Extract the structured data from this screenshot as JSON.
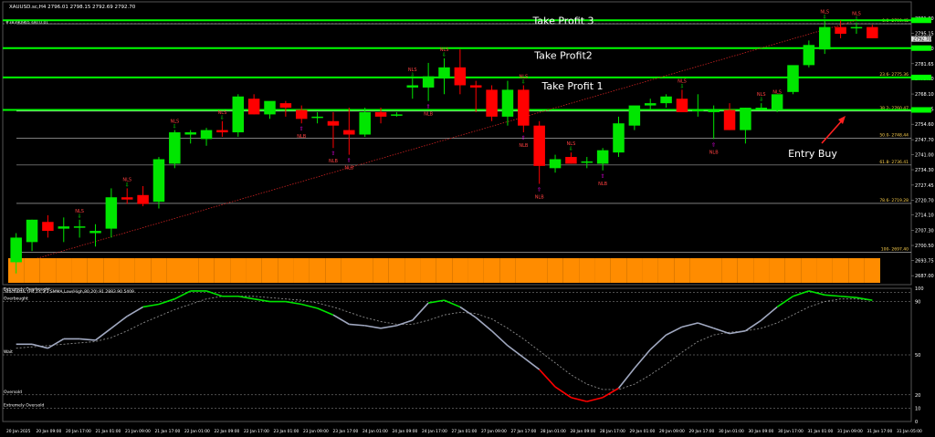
{
  "header": {
    "symbol_line": "XAUUSD.sc,H4  2796.01 2798.15 2792.69 2792.70",
    "order_line": "#38390965 sell 0.01"
  },
  "annotations": {
    "tp3": "Take Profit 3",
    "tp2": "Take Profit2",
    "tp1": "Take Profit 1",
    "entry": "Entry Buy"
  },
  "colors": {
    "background": "#000000",
    "bull": "#00e600",
    "bear": "#ff0000",
    "level_line": "#00ff00",
    "fib_line": "#c8c8c8",
    "volume": "#ff8c00",
    "stoch_main": "#a0a8c0",
    "stoch_signal": "#8c8c8c",
    "text": "#ffffff",
    "arrow_up": "#ff00ff",
    "label": "#ff4040"
  },
  "chart_data": [
    {
      "type": "candlestick",
      "title": "XAUUSD.sc,H4",
      "ylim": [
        2683,
        2806
      ],
      "price_ticks": [
        "2801.90",
        "2795.15",
        "2788.40",
        "2781.65",
        "2775.00",
        "2768.10",
        "2761.35",
        "2754.60",
        "2747.70",
        "2741.00",
        "2734.30",
        "2727.45",
        "2720.70",
        "2714.10",
        "2707.30",
        "2700.50",
        "2693.75",
        "2687.00"
      ],
      "current_price": "2792.70",
      "current_label": "2792.70",
      "fib_levels": [
        {
          "label": "0.0- 2799.45",
          "value": 2799.45
        },
        {
          "label": "23.6- 2775.36",
          "value": 2775.36
        },
        {
          "label": "38.2- 2760.47",
          "value": 2760.47
        },
        {
          "label": "50.0- 2748.44",
          "value": 2748.44
        },
        {
          "label": "61.8- 2736.41",
          "value": 2736.41
        },
        {
          "label": "78.6- 2719.28",
          "value": 2719.28
        },
        {
          "label": "100- 2697.40",
          "value": 2697.4
        }
      ],
      "green_levels": [
        {
          "name": "tp3",
          "value": 2801.0
        },
        {
          "name": "tp2",
          "value": 2788.6
        },
        {
          "name": "tp1",
          "value": 2775.5
        },
        {
          "name": "entry",
          "value": 2761.0
        }
      ],
      "time_labels": [
        "20 Jan 2025",
        "20 Jan 09:00",
        "20 Jan 17:00",
        "21 Jan 01:00",
        "21 Jan 09:00",
        "21 Jan 17:00",
        "22 Jan 01:00",
        "22 Jan 09:00",
        "22 Jan 17:00",
        "23 Jan 01:00",
        "23 Jan 09:00",
        "23 Jan 17:00",
        "24 Jan 01:00",
        "24 Jan 09:00",
        "24 Jan 17:00",
        "27 Jan 01:00",
        "27 Jan 09:00",
        "27 Jan 17:00",
        "28 Jan 01:00",
        "28 Jan 09:00",
        "28 Jan 17:00",
        "29 Jan 01:00",
        "29 Jan 09:00",
        "29 Jan 17:00",
        "30 Jan 01:00",
        "30 Jan 09:00",
        "30 Jan 17:00",
        "31 Jan 01:00",
        "31 Jan 09:00",
        "31 Jan 17:00",
        "31 Jan 05:00"
      ],
      "candles": [
        {
          "o": 2693,
          "h": 2706,
          "l": 2688,
          "c": 2704
        },
        {
          "o": 2702,
          "h": 2712,
          "l": 2698,
          "c": 2712
        },
        {
          "o": 2711,
          "h": 2714,
          "l": 2704,
          "c": 2707
        },
        {
          "o": 2708,
          "h": 2713,
          "l": 2702,
          "c": 2709
        },
        {
          "o": 2709,
          "h": 2712,
          "l": 2704,
          "c": 2709
        },
        {
          "o": 2706,
          "h": 2710,
          "l": 2700,
          "c": 2707
        },
        {
          "o": 2708,
          "h": 2726,
          "l": 2704,
          "c": 2722
        },
        {
          "o": 2722,
          "h": 2726,
          "l": 2719,
          "c": 2721
        },
        {
          "o": 2723,
          "h": 2727,
          "l": 2718,
          "c": 2719
        },
        {
          "o": 2720,
          "h": 2740,
          "l": 2717,
          "c": 2739
        },
        {
          "o": 2737,
          "h": 2752,
          "l": 2735,
          "c": 2751
        },
        {
          "o": 2750,
          "h": 2752,
          "l": 2746,
          "c": 2751
        },
        {
          "o": 2748,
          "h": 2753,
          "l": 2745,
          "c": 2752
        },
        {
          "o": 2752,
          "h": 2756,
          "l": 2749,
          "c": 2751
        },
        {
          "o": 2751,
          "h": 2768,
          "l": 2749,
          "c": 2767
        },
        {
          "o": 2766,
          "h": 2768,
          "l": 2759,
          "c": 2759
        },
        {
          "o": 2759,
          "h": 2764,
          "l": 2757,
          "c": 2765
        },
        {
          "o": 2764,
          "h": 2765,
          "l": 2758,
          "c": 2762
        },
        {
          "o": 2761,
          "h": 2763,
          "l": 2755,
          "c": 2757
        },
        {
          "o": 2758,
          "h": 2760,
          "l": 2755,
          "c": 2758
        },
        {
          "o": 2756,
          "h": 2760,
          "l": 2744,
          "c": 2754
        },
        {
          "o": 2752,
          "h": 2762,
          "l": 2741,
          "c": 2750
        },
        {
          "o": 2750,
          "h": 2762,
          "l": 2749,
          "c": 2760
        },
        {
          "o": 2760,
          "h": 2762,
          "l": 2755,
          "c": 2758
        },
        {
          "o": 2759,
          "h": 2760,
          "l": 2758,
          "c": 2759
        },
        {
          "o": 2771,
          "h": 2775,
          "l": 2766,
          "c": 2772
        },
        {
          "o": 2771,
          "h": 2782,
          "l": 2765,
          "c": 2776
        },
        {
          "o": 2775,
          "h": 2784,
          "l": 2768,
          "c": 2780
        },
        {
          "o": 2780,
          "h": 2788,
          "l": 2768,
          "c": 2772
        },
        {
          "o": 2772,
          "h": 2774,
          "l": 2760,
          "c": 2771
        },
        {
          "o": 2770,
          "h": 2772,
          "l": 2756,
          "c": 2758
        },
        {
          "o": 2758,
          "h": 2774,
          "l": 2754,
          "c": 2770
        },
        {
          "o": 2770,
          "h": 2772,
          "l": 2751,
          "c": 2754
        },
        {
          "o": 2754,
          "h": 2756,
          "l": 2728,
          "c": 2736
        },
        {
          "o": 2735,
          "h": 2741,
          "l": 2733,
          "c": 2739
        },
        {
          "o": 2740,
          "h": 2742,
          "l": 2737,
          "c": 2737
        },
        {
          "o": 2738,
          "h": 2740,
          "l": 2735,
          "c": 2738
        },
        {
          "o": 2737,
          "h": 2744,
          "l": 2734,
          "c": 2743
        },
        {
          "o": 2742,
          "h": 2758,
          "l": 2740,
          "c": 2755
        },
        {
          "o": 2754,
          "h": 2762,
          "l": 2752,
          "c": 2763
        },
        {
          "o": 2763,
          "h": 2766,
          "l": 2761,
          "c": 2764
        },
        {
          "o": 2764,
          "h": 2768,
          "l": 2762,
          "c": 2767
        },
        {
          "o": 2766,
          "h": 2770,
          "l": 2760,
          "c": 2760
        },
        {
          "o": 2761,
          "h": 2768,
          "l": 2758,
          "c": 2761
        },
        {
          "o": 2760,
          "h": 2763,
          "l": 2748,
          "c": 2761
        },
        {
          "o": 2761,
          "h": 2764,
          "l": 2752,
          "c": 2752
        },
        {
          "o": 2752,
          "h": 2762,
          "l": 2746,
          "c": 2762
        },
        {
          "o": 2762,
          "h": 2764,
          "l": 2761,
          "c": 2762
        },
        {
          "o": 2761,
          "h": 2765,
          "l": 2760,
          "c": 2768
        },
        {
          "o": 2769,
          "h": 2780,
          "l": 2768,
          "c": 2781
        },
        {
          "o": 2781,
          "h": 2792,
          "l": 2780,
          "c": 2790
        },
        {
          "o": 2788,
          "h": 2801,
          "l": 2786,
          "c": 2798
        },
        {
          "o": 2798,
          "h": 2801,
          "l": 2793,
          "c": 2795
        },
        {
          "o": 2798,
          "h": 2800,
          "l": 2795,
          "c": 2798
        },
        {
          "o": 2798,
          "h": 2799,
          "l": 2793,
          "c": 2793
        }
      ],
      "markers": [
        {
          "idx": 4,
          "text": "NLS",
          "pos": "above",
          "color": "#00e600"
        },
        {
          "idx": 7,
          "text": "NLS",
          "pos": "above",
          "color": "#00e600"
        },
        {
          "idx": 10,
          "text": "NLS",
          "pos": "above",
          "color": "#00e600"
        },
        {
          "idx": 13,
          "text": "NLS",
          "pos": "above",
          "color": "#00e600"
        },
        {
          "idx": 18,
          "text": "NLB",
          "pos": "below",
          "color": "#ff00ff"
        },
        {
          "idx": 20,
          "text": "NLB",
          "pos": "below",
          "color": "#ff00ff"
        },
        {
          "idx": 21,
          "text": "NLB",
          "pos": "below",
          "color": "#ff00ff"
        },
        {
          "idx": 25,
          "text": "NLS",
          "pos": "above",
          "color": "#00e600"
        },
        {
          "idx": 26,
          "text": "NLB",
          "pos": "below",
          "color": "#ff00ff"
        },
        {
          "idx": 27,
          "text": "NLS",
          "pos": "above",
          "color": "#00e600"
        },
        {
          "idx": 32,
          "text": "NLS",
          "pos": "above",
          "color": "#00e600"
        },
        {
          "idx": 32,
          "text": "NLB",
          "pos": "below",
          "color": "#ff00ff"
        },
        {
          "idx": 33,
          "text": "NLB",
          "pos": "below",
          "color": "#ff00ff"
        },
        {
          "idx": 35,
          "text": "NLS",
          "pos": "above",
          "color": "#00e600"
        },
        {
          "idx": 37,
          "text": "NLB",
          "pos": "below",
          "color": "#ff00ff"
        },
        {
          "idx": 42,
          "text": "NLS",
          "pos": "above",
          "color": "#00e600"
        },
        {
          "idx": 44,
          "text": "NLB",
          "pos": "below",
          "color": "#ff00ff"
        },
        {
          "idx": 47,
          "text": "NLS",
          "pos": "above",
          "color": "#00e600"
        },
        {
          "idx": 48,
          "text": "NLS",
          "pos": "above",
          "color": "#00e600"
        },
        {
          "idx": 51,
          "text": "NLS",
          "pos": "above",
          "color": "#00e600"
        },
        {
          "idx": 53,
          "text": "NLS",
          "pos": "above",
          "color": "#00e600"
        }
      ],
      "volume_ylim": [
        0,
        100
      ],
      "volume": [
        80,
        80,
        80,
        80,
        80,
        80,
        80,
        80,
        80,
        80,
        80,
        80,
        80,
        80,
        80,
        80,
        80,
        80,
        80,
        80,
        80,
        80,
        80,
        80,
        80,
        80,
        80,
        80,
        80,
        80,
        80,
        80,
        80,
        80,
        80,
        80,
        80,
        80,
        80,
        80,
        80,
        80,
        80,
        80,
        80,
        80,
        80,
        80,
        80,
        80,
        80,
        80,
        80,
        80,
        80
      ]
    },
    {
      "type": "line",
      "title": "Stochastic (H4,14,3,3,SMMA,Low/High,80,20) 91.2883 90.5409",
      "ylim": [
        0,
        100
      ],
      "y_ticks": [
        "100",
        "90",
        "50",
        "20",
        "10",
        "0"
      ],
      "zones": [
        {
          "label": "Extremely Overbought",
          "value": 97
        },
        {
          "label": "Overbought",
          "value": 90
        },
        {
          "label": "Wait",
          "value": 50
        },
        {
          "label": "Oversold",
          "value": 20
        },
        {
          "label": "Extremely Oversold",
          "value": 10
        }
      ],
      "series": [
        {
          "name": "main",
          "values": [
            58,
            58,
            55,
            62,
            62,
            61,
            70,
            79,
            86,
            88,
            92,
            98,
            98,
            94,
            94,
            92,
            90,
            90,
            88,
            85,
            80,
            73,
            72,
            70,
            72,
            76,
            89,
            91,
            86,
            78,
            68,
            57,
            48,
            39,
            26,
            18,
            15,
            18,
            25,
            40,
            54,
            65,
            71,
            74,
            70,
            66,
            68,
            76,
            86,
            94,
            98,
            95,
            94,
            93,
            91
          ]
        },
        {
          "name": "signal",
          "values": [
            55,
            56,
            57,
            58,
            59,
            60,
            63,
            68,
            74,
            79,
            84,
            88,
            92,
            94,
            94,
            94,
            93,
            92,
            91,
            89,
            86,
            82,
            78,
            75,
            73,
            73,
            76,
            80,
            82,
            81,
            77,
            70,
            62,
            53,
            44,
            35,
            28,
            24,
            24,
            28,
            35,
            43,
            52,
            60,
            65,
            67,
            68,
            70,
            74,
            80,
            86,
            90,
            92,
            92,
            91
          ]
        }
      ],
      "red_segment": [
        33,
        38
      ]
    }
  ]
}
